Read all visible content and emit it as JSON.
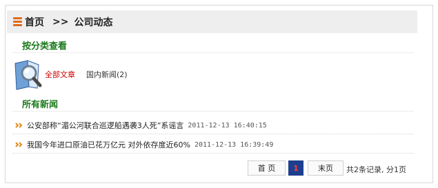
{
  "breadcrumb": {
    "home": "首页",
    "separator": ">>",
    "current": "公司动态"
  },
  "category_section": {
    "title": "按分类查看",
    "all_label": "全部文章",
    "category_label": "国内新闻(2)"
  },
  "news_section": {
    "title": "所有新闻",
    "items": [
      {
        "title": "公安部称“湄公河联合巡逻船遇袭3人死”系谣言",
        "date": "2011-12-13 16:40:15"
      },
      {
        "title": "我国今年进口原油已花万亿元 对外依存度近60%",
        "date": "2011-12-13 16:39:49"
      }
    ]
  },
  "pagination": {
    "first_label": "首 页",
    "current_page": "1",
    "last_label": "末页",
    "summary": "共2条记录, 分1页"
  },
  "colors": {
    "accent_green": "#1b7a1b",
    "link_red": "#cc0000",
    "current_page_bg": "#1e3f8f",
    "header_icon_orange": "#e06a1a"
  },
  "icons": [
    "list-icon",
    "magnifier-book-icon",
    "double-arrow-icon"
  ]
}
